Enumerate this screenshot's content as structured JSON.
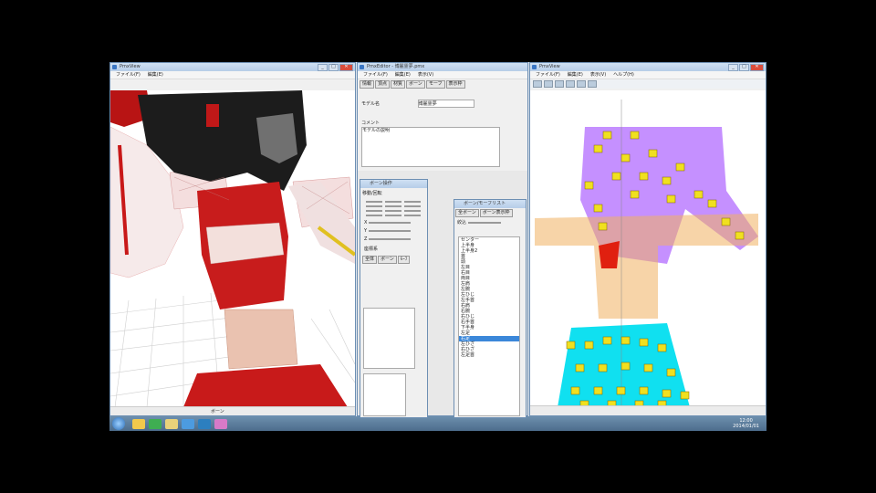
{
  "left_window": {
    "title": "PmxView",
    "menu": [
      "ファイル(F)",
      "編集(E)"
    ],
    "status_label": "ボーン"
  },
  "center_window": {
    "title": "PmxEditor - 博麗霊夢.pmx",
    "menu": [
      "ファイル(F)",
      "編集(E)",
      "表示(V)"
    ],
    "tabs": [
      "情報",
      "頂点",
      "材質",
      "ボーン",
      "モーフ",
      "表示枠",
      "剛体",
      "Joint"
    ],
    "model_name_label": "モデル名",
    "model_name_value": "博麗霊夢",
    "comment_label": "コメント",
    "comment_text": "モデルの説明"
  },
  "bone_panel": {
    "title": "ボーン操作",
    "header": "移動/回転",
    "rows": [
      "X",
      "Y",
      "Z"
    ],
    "option_label": "座標系",
    "sub_tabs": [
      "全体",
      "ボーン",
      "ﾓｰﾌ",
      "材質"
    ]
  },
  "list_window": {
    "title": "ボーン/モーフリスト",
    "tabs": [
      "全ボーン",
      "ボーン表示枠"
    ],
    "filter_label": "絞込",
    "selected_index": 18,
    "items": [
      "センター",
      "上半身",
      "上半身2",
      "首",
      "頭",
      "左目",
      "右目",
      "両目",
      "左肩",
      "左腕",
      "左ひじ",
      "左手首",
      "右肩",
      "右腕",
      "右ひじ",
      "右手首",
      "下半身",
      "左足",
      "右足",
      "左ひざ",
      "右ひざ",
      "左足首"
    ]
  },
  "right_window": {
    "title": "PmxView",
    "menu": [
      "ファイル(F)",
      "編集(E)",
      "表示(V)",
      "ヘルプ(H)"
    ]
  },
  "taskbar": {
    "time": "12:00",
    "date": "2014/01/01"
  },
  "colors": {
    "accent": "#3b87d9",
    "bone_marker": "#f0e020",
    "hair_overlay": "#b26bff",
    "skirt_overlay": "#10e0f0",
    "body_overlay": "#f0b060",
    "costume_red": "#cc1a1a"
  }
}
